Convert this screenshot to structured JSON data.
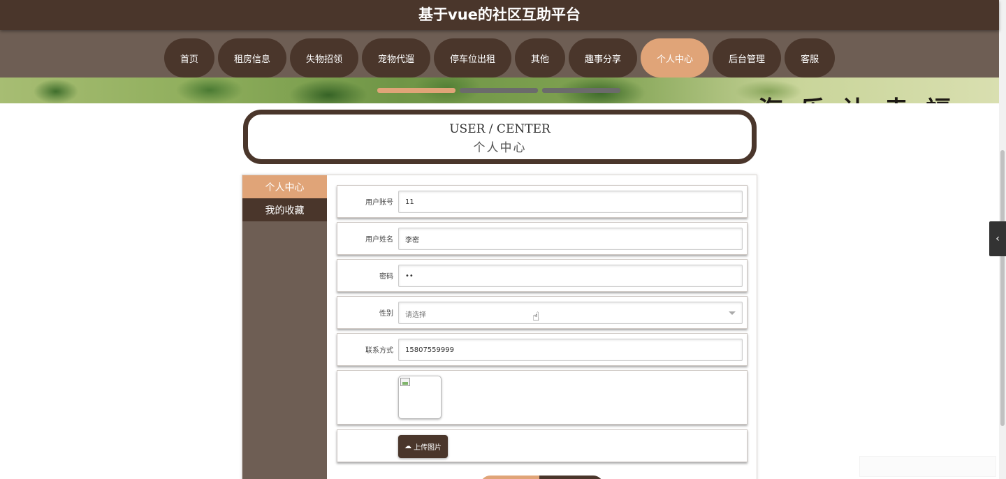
{
  "header": {
    "title": "基于vue的社区互助平台"
  },
  "nav": {
    "items": [
      {
        "label": "首页",
        "active": false
      },
      {
        "label": "租房信息",
        "active": false
      },
      {
        "label": "失物招领",
        "active": false
      },
      {
        "label": "宠物代遛",
        "active": false
      },
      {
        "label": "停车位出租",
        "active": false
      },
      {
        "label": "其他",
        "active": false
      },
      {
        "label": "趣事分享",
        "active": false
      },
      {
        "label": "个人中心",
        "active": true
      },
      {
        "label": "后台管理",
        "active": false
      },
      {
        "label": "客服",
        "active": false
      }
    ]
  },
  "banner": {
    "text": "海乐让幸福"
  },
  "section": {
    "title_en": "USER / CENTER",
    "title_cn": "个人中心"
  },
  "sidebar": {
    "items": [
      {
        "label": "个人中心",
        "active": true
      },
      {
        "label": "我的收藏",
        "active": false
      }
    ]
  },
  "form": {
    "username": {
      "label": "用户账号",
      "value": "11"
    },
    "name": {
      "label": "用户姓名",
      "value": "李密"
    },
    "password": {
      "label": "密码",
      "value": "••"
    },
    "gender": {
      "label": "性别",
      "placeholder": "请选择"
    },
    "phone": {
      "label": "联系方式",
      "value": "15807559999"
    },
    "upload_label": "上传图片"
  },
  "icons": {
    "side_toggle": "chevron-left-icon",
    "upload": "cloud-upload-icon",
    "select": "chevron-down-icon",
    "pointer": "hand-pointer-cursor"
  },
  "colors": {
    "header_bg": "#4a362b",
    "nav_bg": "#6e5e54",
    "accent": "#e0a478",
    "button_dark": "#4a362b"
  }
}
